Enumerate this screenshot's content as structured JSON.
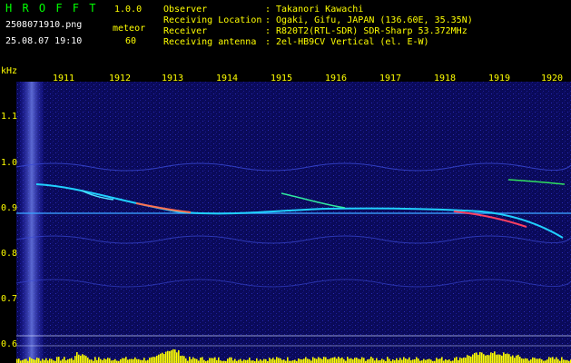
{
  "header": {
    "app_name": "H R O F F T",
    "version": "1.0.0",
    "filename": "2508071910.png",
    "datetime": "25.08.07 19:10",
    "mode_label": "meteor",
    "count": "60",
    "info_rows": [
      {
        "label": "Observer",
        "sep": ":",
        "value": "Takanori Kawachi"
      },
      {
        "label": "Receiving Location",
        "sep": ":",
        "value": "Ogaki, Gifu, JAPAN (136.60E, 35.35N)"
      },
      {
        "label": "Receiver",
        "sep": ":",
        "value": "R820T2(RTL-SDR) SDR-Sharp 53.372MHz"
      },
      {
        "label": "Receiving antenna",
        "sep": ":",
        "value": "2el-HB9CV Vertical (el. E-W)"
      }
    ]
  },
  "spectrogram": {
    "y_unit": "kHz",
    "time_ticks": [
      "1911",
      "1912",
      "1913",
      "1914",
      "1915",
      "1916",
      "1917",
      "1918",
      "1919",
      "1920"
    ],
    "freq_ticks": [
      "1.1",
      "1.0",
      "0.9",
      "0.8",
      "0.7",
      "0.6"
    ],
    "colors": {
      "background": "#0a0a5a",
      "axis_text": "#ffff00",
      "trace": "#00c0ff",
      "bottom_bars": "#ffff00"
    }
  }
}
